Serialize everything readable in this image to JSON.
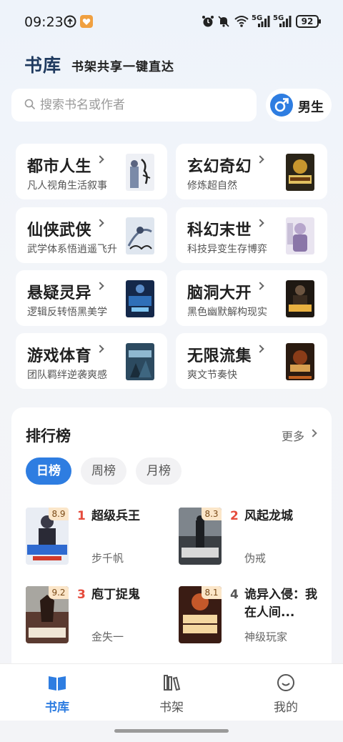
{
  "status_bar": {
    "time": "09:23",
    "battery": "92",
    "network_1": "5G",
    "network_2": "5G"
  },
  "header": {
    "title": "书库",
    "slogan": "书架共享一键直达"
  },
  "search": {
    "placeholder": "搜索书名或作者",
    "gender_label": "男生"
  },
  "categories": [
    {
      "name": "都市人生",
      "desc": "凡人视角生活叙事"
    },
    {
      "name": "玄幻奇幻",
      "desc": "修炼超自然"
    },
    {
      "name": "仙侠武侠",
      "desc": "武学体系悟逍遥飞升"
    },
    {
      "name": "科幻末世",
      "desc": "科技异变生存博弈"
    },
    {
      "name": "悬疑灵异",
      "desc": "逻辑反转悟黑美学"
    },
    {
      "name": "脑洞大开",
      "desc": "黑色幽默解构现实"
    },
    {
      "name": "游戏体育",
      "desc": "团队羁绊逆袭爽感"
    },
    {
      "name": "无限流集",
      "desc": "爽文节奏快"
    }
  ],
  "ranking": {
    "title": "排行榜",
    "more": "更多",
    "tabs": [
      "日榜",
      "周榜",
      "月榜"
    ],
    "books": [
      {
        "rank": "1",
        "name": "超级兵王",
        "author": "步千帆",
        "score": "8.9"
      },
      {
        "rank": "2",
        "name": "风起龙城",
        "author": "伪戒",
        "score": "8.3"
      },
      {
        "rank": "3",
        "name": "庖丁捉鬼",
        "author": "金失一",
        "score": "9.2"
      },
      {
        "rank": "4",
        "name": "诡异入侵：我在人间...",
        "author": "神级玩家",
        "score": "8.1"
      }
    ]
  },
  "bottom_nav": {
    "items": [
      "书库",
      "书架",
      "我的"
    ],
    "active": "书库"
  },
  "colors": {
    "accent": "#2e7de1",
    "rank_red": "#e54b3c",
    "score_bg": "#fbe6c9"
  }
}
